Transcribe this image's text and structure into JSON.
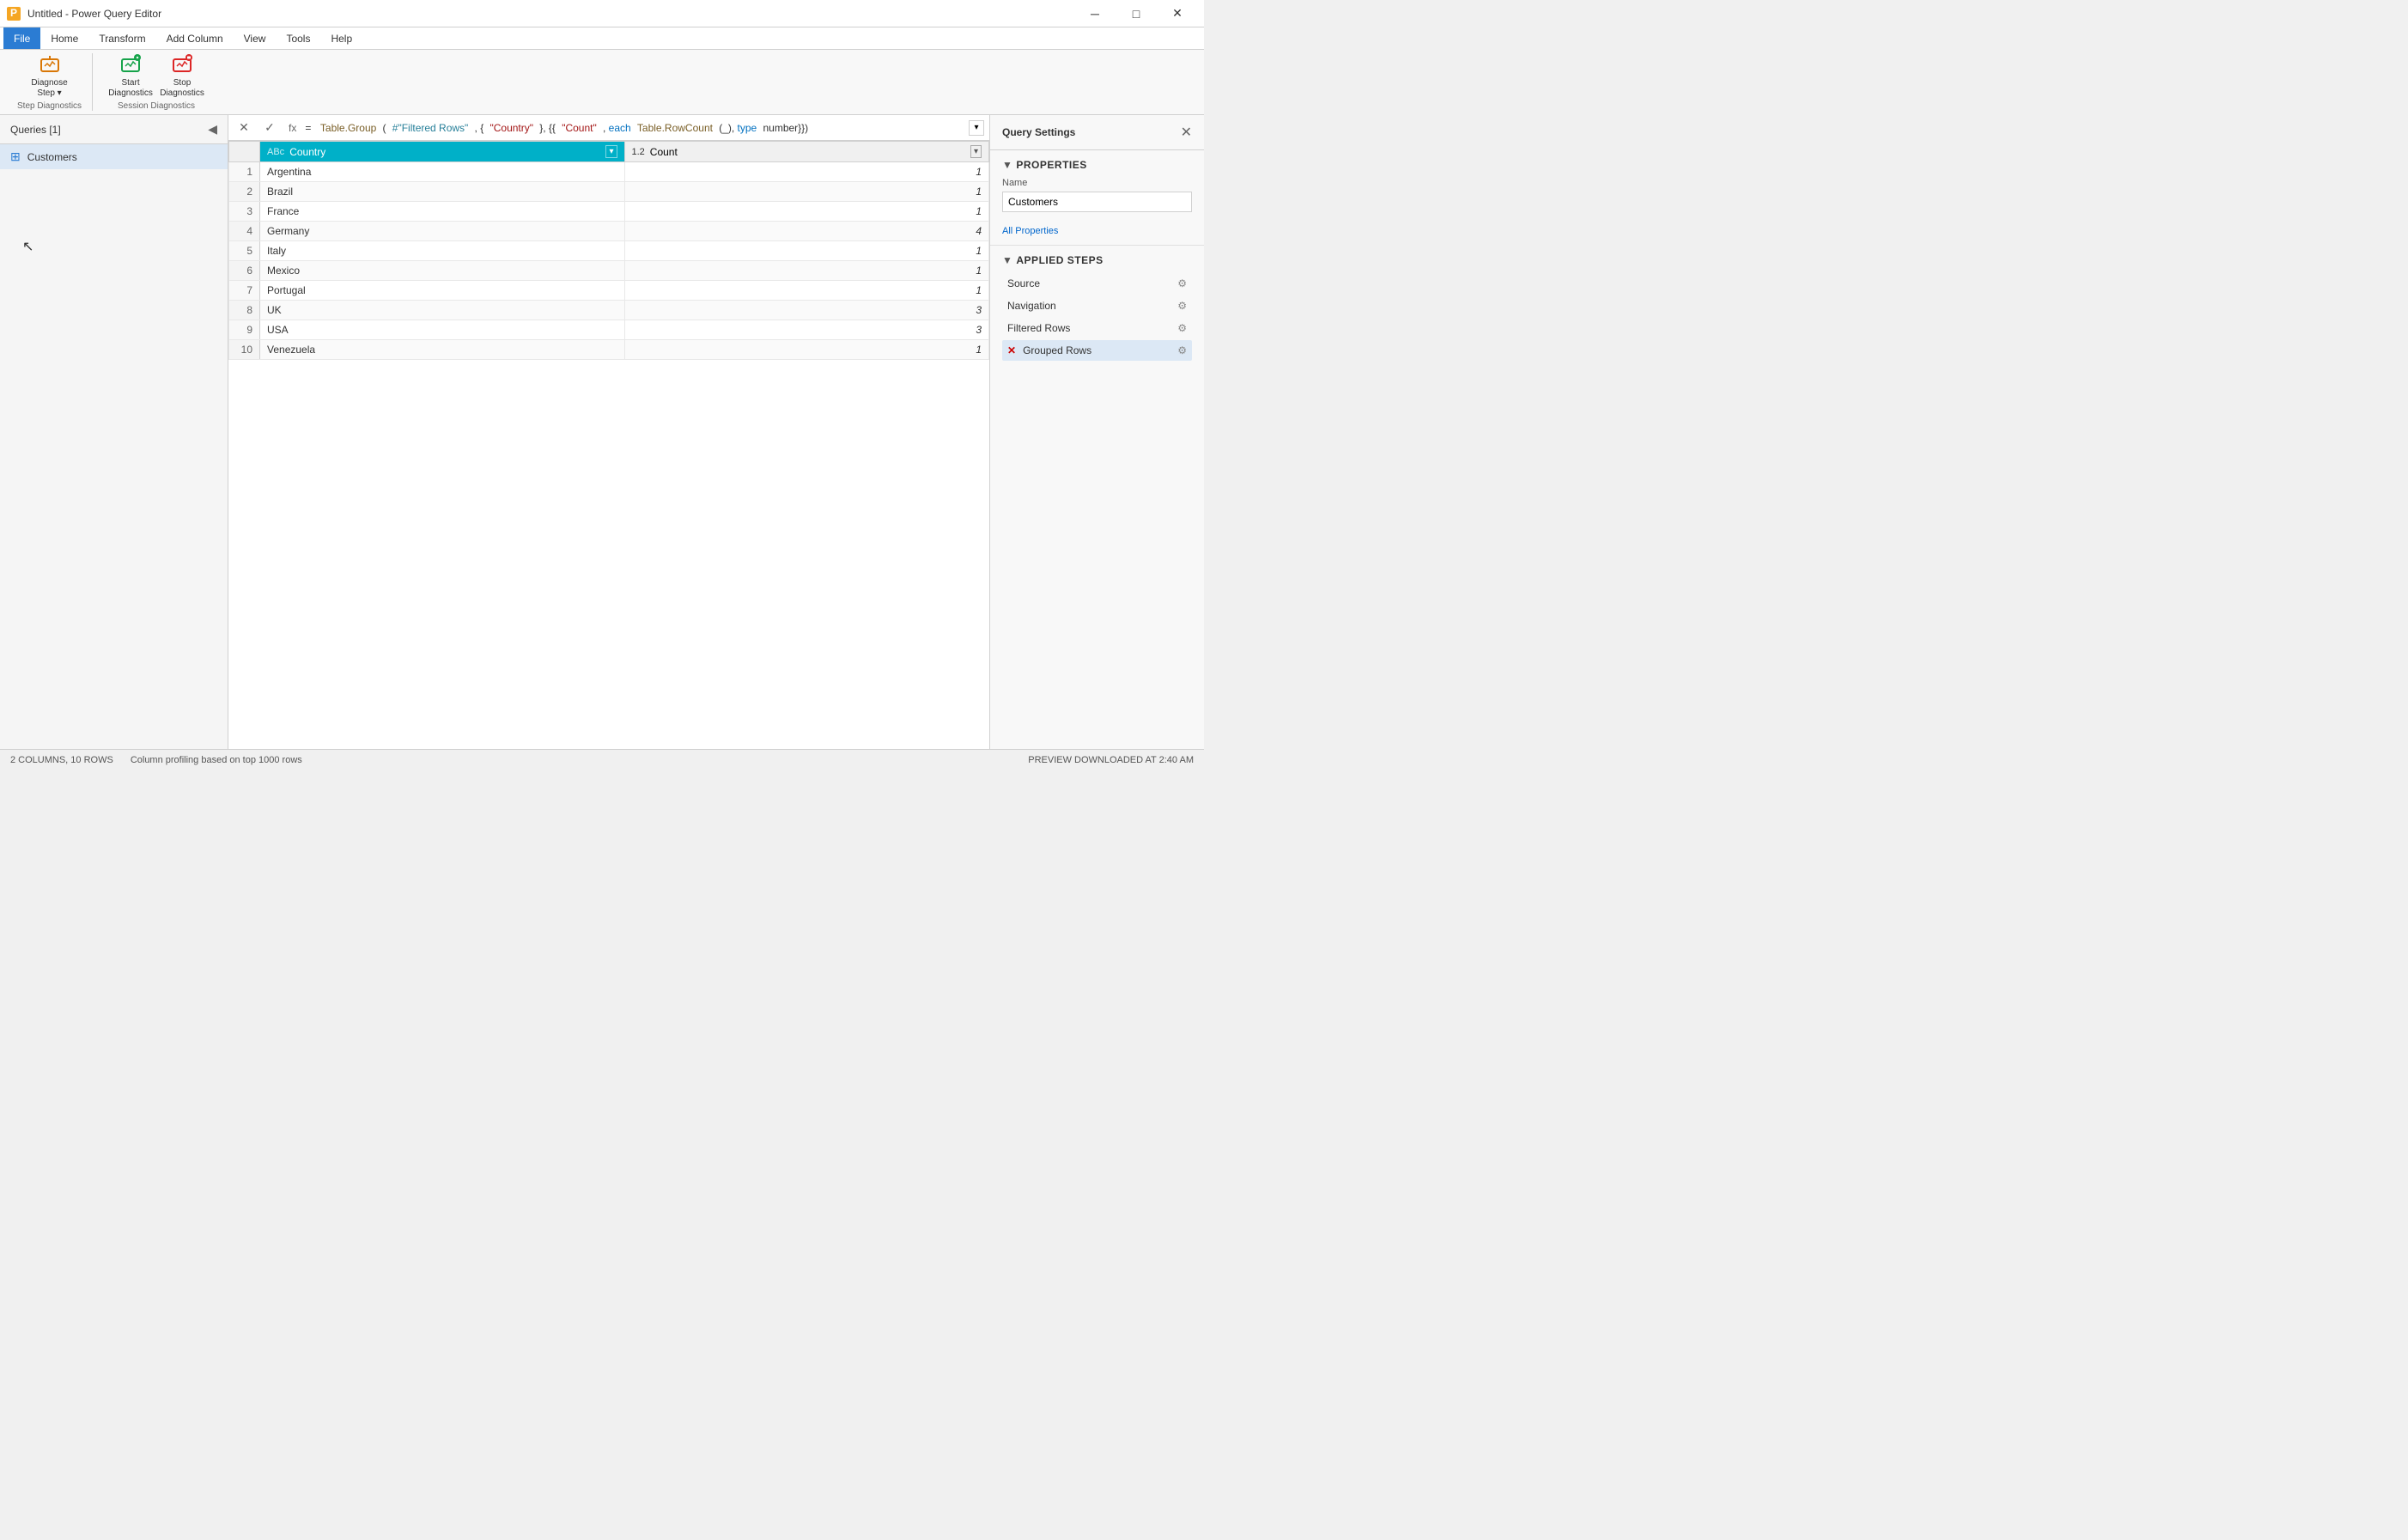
{
  "titleBar": {
    "title": "Untitled - Power Query Editor",
    "minimizeLabel": "─",
    "restoreLabel": "□",
    "closeLabel": "✕"
  },
  "ribbonTabs": [
    {
      "label": "File",
      "active": true
    },
    {
      "label": "Home",
      "active": false
    },
    {
      "label": "Transform",
      "active": false
    },
    {
      "label": "Add Column",
      "active": false
    },
    {
      "label": "View",
      "active": false
    },
    {
      "label": "Tools",
      "active": false
    },
    {
      "label": "Help",
      "active": false
    }
  ],
  "ribbon": {
    "stepDiagnosticsGroup": {
      "label": "Step Diagnostics",
      "diagnoseBtn": "Diagnose\nStep ▾",
      "diagnoseLabel": "Diagnose\nStep"
    },
    "sessionDiagnosticsGroup": {
      "label": "Session Diagnostics",
      "startBtn": "Start\nDiagnostics",
      "stopBtn": "Stop\nDiagnostics"
    }
  },
  "queriesPanel": {
    "header": "Queries [1]",
    "items": [
      {
        "label": "Customers",
        "icon": "table"
      }
    ]
  },
  "formulaBar": {
    "cancelLabel": "✕",
    "confirmLabel": "✓",
    "fxLabel": "fx",
    "formula": "= Table.Group(#\"Filtered Rows\", {\"Country\"}, {{\"Count\", each Table.RowCount(_), type number}})",
    "expandLabel": "▾"
  },
  "dataTable": {
    "columns": [
      {
        "label": "Country",
        "type": "ABc",
        "isActive": true
      },
      {
        "label": "1.2  Count",
        "type": "1.2",
        "isActive": false
      }
    ],
    "rows": [
      {
        "num": 1,
        "country": "Argentina",
        "count": "1"
      },
      {
        "num": 2,
        "country": "Brazil",
        "count": "1"
      },
      {
        "num": 3,
        "country": "France",
        "count": "1"
      },
      {
        "num": 4,
        "country": "Germany",
        "count": "4"
      },
      {
        "num": 5,
        "country": "Italy",
        "count": "1"
      },
      {
        "num": 6,
        "country": "Mexico",
        "count": "1"
      },
      {
        "num": 7,
        "country": "Portugal",
        "count": "1"
      },
      {
        "num": 8,
        "country": "UK",
        "count": "3"
      },
      {
        "num": 9,
        "country": "USA",
        "count": "3"
      },
      {
        "num": 10,
        "country": "Venezuela",
        "count": "1"
      }
    ]
  },
  "querySettings": {
    "title": "Query Settings",
    "closeLabel": "✕",
    "propertiesLabel": "PROPERTIES",
    "nameLabel": "Name",
    "nameValue": "Customers",
    "allPropertiesLabel": "All Properties",
    "appliedStepsLabel": "APPLIED STEPS",
    "steps": [
      {
        "label": "Source",
        "hasGear": true,
        "isActive": false,
        "hasX": false
      },
      {
        "label": "Navigation",
        "hasGear": true,
        "isActive": false,
        "hasX": false
      },
      {
        "label": "Filtered Rows",
        "hasGear": true,
        "isActive": false,
        "hasX": false
      },
      {
        "label": "Grouped Rows",
        "hasGear": true,
        "isActive": true,
        "hasX": true
      }
    ]
  },
  "statusBar": {
    "columns": "2 COLUMNS, 10 ROWS",
    "profilingNote": "Column profiling based on top 1000 rows",
    "previewNote": "PREVIEW DOWNLOADED AT 2:40 AM"
  }
}
